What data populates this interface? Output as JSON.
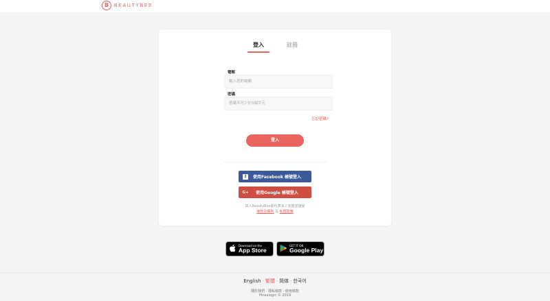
{
  "header": {
    "logo_mark": "B",
    "logo_text": "BEAUTYBEE"
  },
  "tabs": {
    "login": "登入",
    "register": "註冊"
  },
  "form": {
    "email_label": "電郵",
    "email_placeholder": "輸入您的電郵",
    "password_label": "密碼",
    "password_placeholder": "密碼不可少於6個字元",
    "forgot": "忘記密碼?",
    "submit": "登入"
  },
  "social": {
    "facebook_icon": "f",
    "facebook_label": "使用Facebook 帳號登入",
    "google_icon": "G+",
    "google_label": "使用Google 帳號登入"
  },
  "terms": {
    "line1": "如入BeautyBee即代表本人完整並接受",
    "terms_link": "條款及細則",
    "and": "及",
    "privacy_link": "私隱政策"
  },
  "stores": {
    "appstore_small": "Download on the",
    "appstore_big": "App Store",
    "googleplay_small": "GET IT ON",
    "googleplay_big": "Google Play"
  },
  "footer": {
    "languages": [
      "English",
      "繁體",
      "简体",
      "한국어"
    ],
    "active_language": "繁體",
    "links": [
      "關於我們",
      "隱私條款",
      "使用條款"
    ],
    "copyright": "Pinealogic © 2019"
  },
  "colors": {
    "accent": "#e8615c",
    "facebook": "#3c5a99",
    "google": "#cf4e42"
  }
}
